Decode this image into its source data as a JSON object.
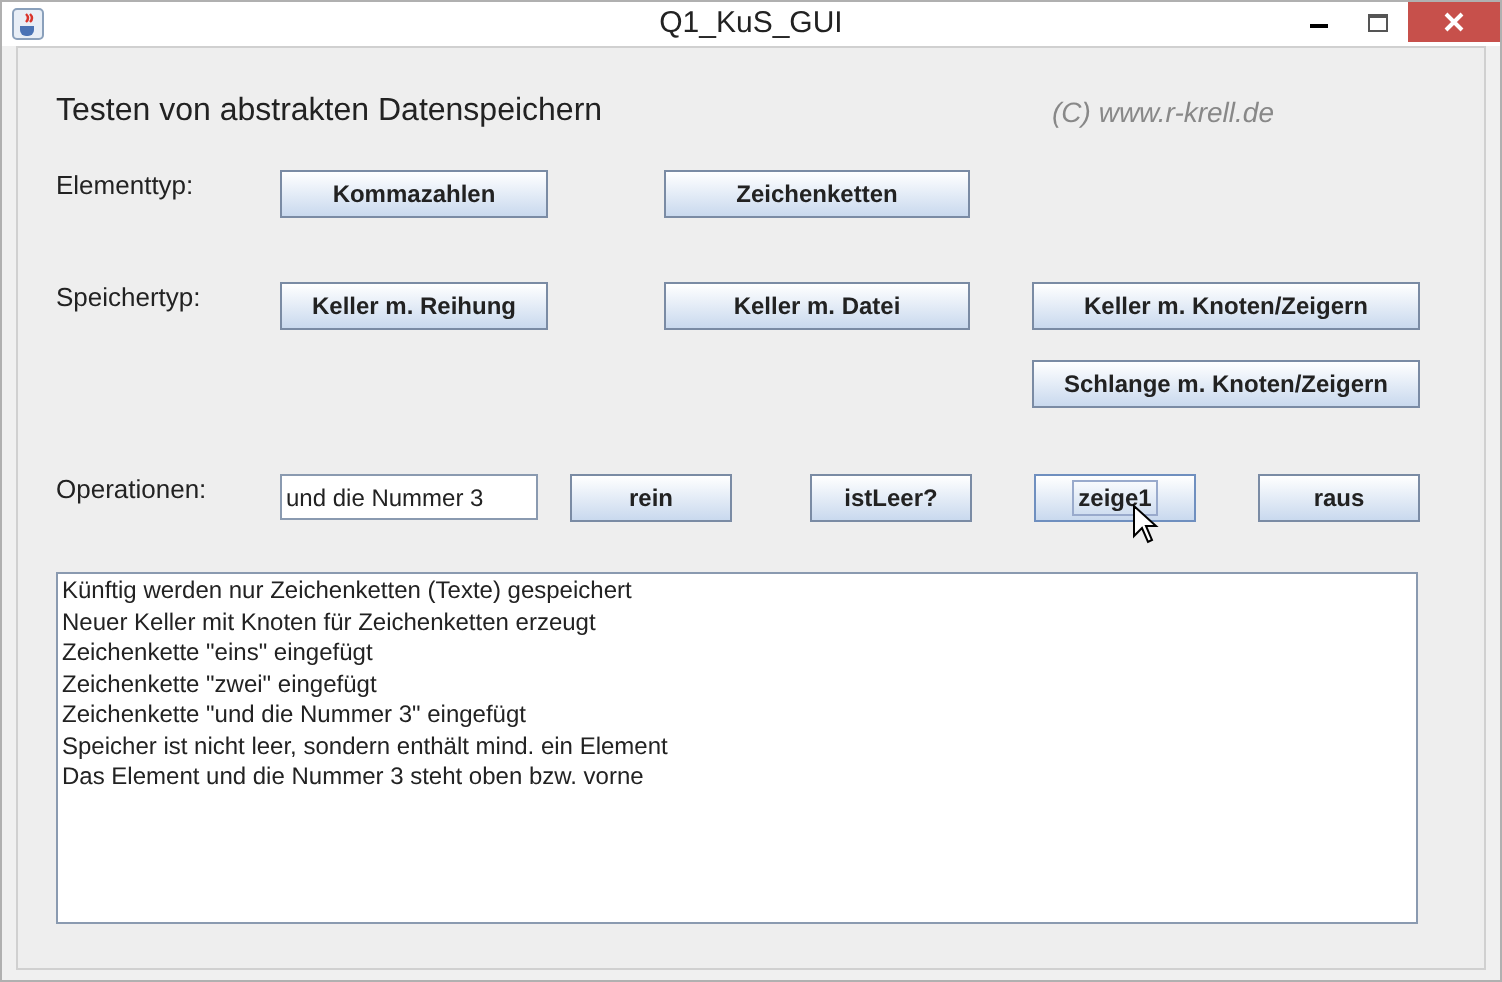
{
  "window": {
    "title": "Q1_KuS_GUI"
  },
  "heading": "Testen von abstrakten Datenspeichern",
  "copyright": "(C) www.r-krell.de",
  "element_type": {
    "label": "Elementtyp:",
    "buttons": [
      {
        "label": "Kommazahlen",
        "focused": false
      },
      {
        "label": "Zeichenketten",
        "focused": false
      }
    ]
  },
  "storage_type": {
    "label": "Speichertyp:",
    "buttons": [
      {
        "label": "Keller m. Reihung",
        "focused": false
      },
      {
        "label": "Keller m. Datei",
        "focused": false
      },
      {
        "label": "Keller m. Knoten/Zeigern",
        "focused": false
      },
      {
        "label": "Schlange m. Knoten/Zeigern",
        "focused": false
      }
    ]
  },
  "operations": {
    "label": "Operationen:",
    "input": {
      "value": "und die Nummer 3"
    },
    "buttons": [
      {
        "label": "rein",
        "focused": false
      },
      {
        "label": "istLeer?",
        "focused": false
      },
      {
        "label": "zeige1",
        "focused": true
      },
      {
        "label": "raus",
        "focused": false
      }
    ]
  },
  "log": [
    "Künftig werden nur Zeichenketten (Texte) gespeichert",
    "Neuer Keller mit Knoten für Zeichenketten erzeugt",
    "Zeichenkette \"eins\" eingefügt",
    "Zeichenkette \"zwei\" eingefügt",
    "Zeichenkette \"und die Nummer 3\" eingefügt",
    "Speicher ist nicht leer, sondern enthält mind. ein Element",
    "Das Element und die Nummer 3 steht oben bzw. vorne"
  ]
}
